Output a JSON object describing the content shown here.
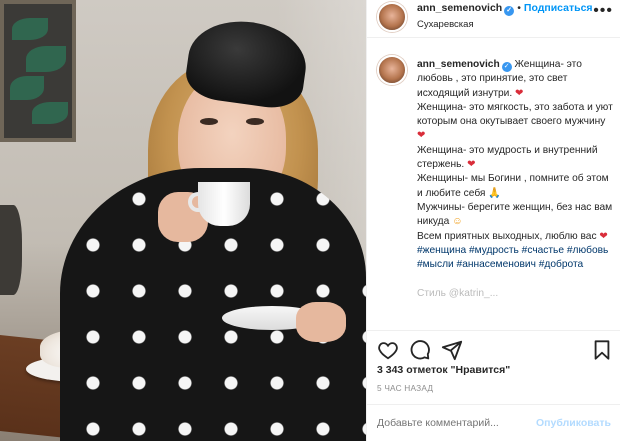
{
  "header": {
    "username": "ann_semenovich",
    "separator": "•",
    "follow_label": "Подписаться",
    "location": "Сухаревская",
    "more_icon": "more-horizontal-icon"
  },
  "caption": {
    "username": "ann_semenovich",
    "lines": [
      "Женщина- это любовь , это принятие, это свет исходящий изнутри.",
      "Женщина- это мягкость, это забота и уют",
      "которым она окутывает своего мужчину",
      "Женщина- это мудрость и внутренний стержень.",
      "Женщины- мы Богини , помните об этом и любите себя",
      "Мужчины- берегите женщин, без нас вам никуда",
      "Всем приятных выходных, люблю вас"
    ],
    "hashtags": "#женщина #мудрость #счастье #любовь #мысли #аннасеменович #доброта",
    "faded_line": "Стиль @katrin_..."
  },
  "actions": {
    "like_icon": "heart-icon",
    "comment_icon": "comment-icon",
    "share_icon": "share-icon",
    "save_icon": "bookmark-icon"
  },
  "likes": "3 343 отметок \"Нравится\"",
  "time_ago": "5 ЧАС НАЗАД",
  "comment": {
    "placeholder": "Добавьте комментарий...",
    "publish_label": "Опубликовать"
  },
  "colors": {
    "accent": "#0095f6",
    "hashtag": "#00376b",
    "verified": "#3897f0",
    "heart_emoji": "#d92d3a"
  }
}
